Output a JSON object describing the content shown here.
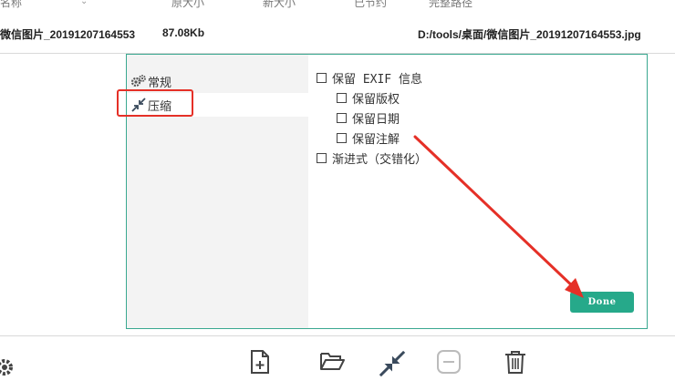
{
  "table_header": {
    "name": "名称",
    "original_size": "原大小",
    "new_size": "新大小",
    "saved": "已节约",
    "full_path": "完整路径"
  },
  "file_row": {
    "name": "微信图片_20191207164553",
    "original_size": "87.08Kb",
    "full_path": "D:/tools/桌面/微信图片_20191207164553.jpg"
  },
  "sidebar": {
    "items": [
      {
        "label": "常规",
        "icon": "gears-icon"
      },
      {
        "label": "压缩",
        "icon": "compress-icon",
        "active": true
      }
    ]
  },
  "options": {
    "keep_exif": "保留 EXIF 信息",
    "keep_copyright": "保留版权",
    "keep_date": "保留日期",
    "keep_comments": "保留注解",
    "progressive": "渐进式（交错化）"
  },
  "done_label": "Done",
  "toolbar": [
    "add-file-icon",
    "open-folder-icon",
    "compress-icon",
    "remove-icon",
    "trash-icon"
  ],
  "colors": {
    "accent": "#26a98a",
    "annotation_red": "#e53027",
    "dialog_border": "#3aa890"
  }
}
